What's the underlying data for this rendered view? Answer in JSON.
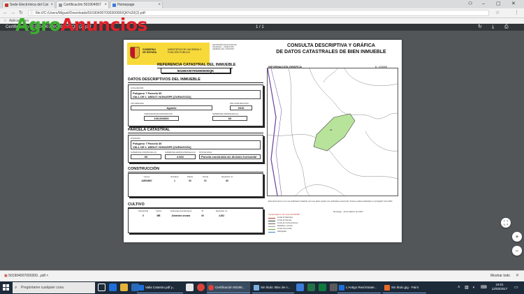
{
  "browser": {
    "tabs": [
      {
        "label": "Sede Electrónica del Cat",
        "color": "#c0392b"
      },
      {
        "label": "Certificación 501904007",
        "color": "#777777"
      },
      {
        "label": "Homepage",
        "color": "#3b7dd8"
      }
    ],
    "url": "file:///C:/Users/Miguel/Downloads/501904007000300000QK%20(2).pdf",
    "bookmarks_label": "Aplicaciones"
  },
  "watermark": {
    "part1": "Agro",
    "part2": "Anuncios"
  },
  "pdf_toolbar": {
    "filename": "Certificación 501904007000300000QK (2).pdf",
    "page_indicator": "1 / 1"
  },
  "document": {
    "gov": {
      "line1": "GOBIERNO DE ESPAÑA",
      "line2": "MINISTERIO DE HACIENDA Y FUNCIÓN PÚBLICA"
    },
    "secretaria": "SECRETARÍA DE ESTADO DE HACIENDA — DIRECCIÓN GENERAL DEL CATASTRO",
    "title_line1": "CONSULTA DESCRIPTIVA Y GRÁFICA",
    "title_line2": "DE DATOS CATASTRALES DE BIEN INMUEBLE",
    "ref_heading": "REFERENCIA CATASTRAL DEL INMUEBLE",
    "ref_value": "50190A007003000000QK",
    "datos_heading": "DATOS DESCRIPTIVOS DEL INMUEBLE",
    "loc_label": "LOCALIZACIÓN",
    "loc_line1": "Polígono 7 Parcela 30",
    "loc_line2": "VALL DE L´ABSUT. NONASPE [ZARAGOZA]",
    "uso_label": "USO PRINCIPAL",
    "uso_value": "Agrario",
    "anio_label": "AÑO CONSTRUCCIÓN",
    "anio_value": "2010",
    "coef_label": "COEFICIENTE DE PARTICIPACIÓN",
    "coef_value": "100,000000",
    "sup_label": "SUPERFICIE CONSTRUIDA [m²]",
    "sup_value": "60",
    "parcela_heading": "PARCELA CATASTRAL",
    "sit_label": "SITUACIÓN",
    "sit_line1": "Polígono 7 Parcela 30",
    "sit_line2": "VALL DE L´ABSUT. NONASPE [ZARAGOZA]",
    "supc_label": "SUPERFICIE CONSTRUIDA [m²]",
    "supc_value": "60",
    "supg_label": "SUPERFICIE GRÁFICA PARCELA [m²]",
    "supg_value": "4.602",
    "tipo_label": "TIPO DE FINCA",
    "tipo_value": "Parcela construida sin división horizontal",
    "construccion_heading": "CONSTRUCCIÓN",
    "construccion_cols": [
      "Uso/os",
      "Escalera",
      "Planta",
      "Puerta",
      "Superficie m²"
    ],
    "construccion_row": [
      "AGRARIO",
      "1",
      "00",
      "01",
      "60"
    ],
    "cultivo_heading": "CULTIVO",
    "cultivo_cols": [
      "Subparcela",
      "Cultivo",
      "Cultivo/aprovechamiento",
      "IP",
      "Superficie m²"
    ],
    "cultivo_row": [
      "0",
      "MB",
      "Almendro secano",
      "00",
      "4.452"
    ],
    "map_heading": "INFORMACIÓN GRÁFICA",
    "map_scale": "E: 1/3000",
    "map_parcel_label": "30",
    "cert_note": "Este documento no es una certificación catastral, pero sus datos pueden ser verificados a través del \"Acceso a datos catastrales no protegidos\" de la SEC",
    "cert_date": "Domingo , 12 de Marzo de 2017",
    "legend": [
      "Límite de Manzana",
      "Límite de Parcela",
      "Límite de Construcciones",
      "Mobiliario y aceras",
      "Límite zona verde",
      "Hidrografía"
    ],
    "legend_top": "Coordenadas U.T.M. Huso 30 ETRS89"
  },
  "download": {
    "file": "501904007000300...pdf",
    "show_all": "Mostrar todo"
  },
  "taskbar": {
    "search_placeholder": "Pregúntame cualquier cosa",
    "apps": [
      "Valia Catastro.pdf y...",
      "Certificación 50190...",
      "Sin título: Bloc de n...",
      "L'Antigo Real Estate...",
      "Sin título.jpg - Paint"
    ],
    "time": "19:01",
    "date": "12/03/2017"
  }
}
